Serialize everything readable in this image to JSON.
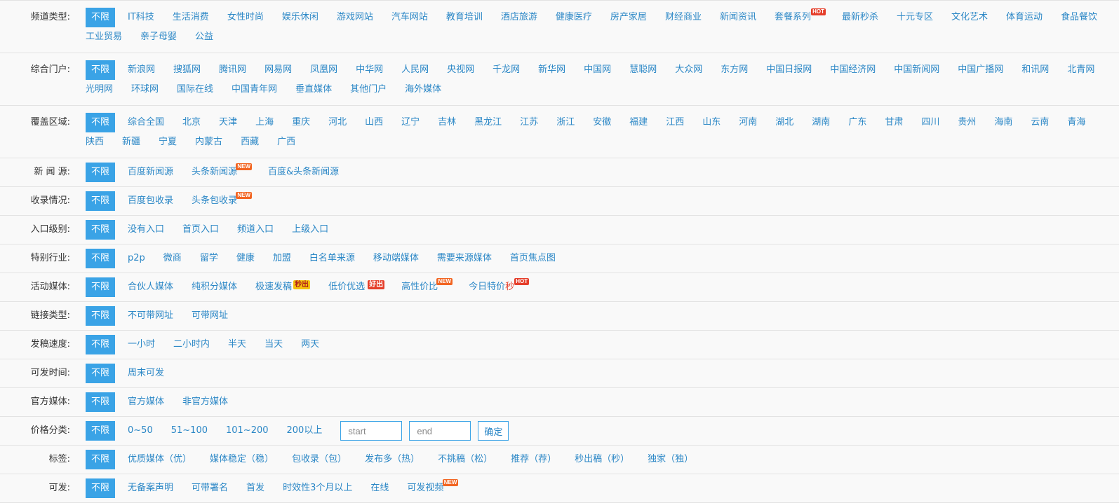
{
  "rows": [
    {
      "label": "频道类型:",
      "active": "不限",
      "items": [
        {
          "text": "IT科技"
        },
        {
          "text": "生活消费"
        },
        {
          "text": "女性时尚"
        },
        {
          "text": "娱乐休闲"
        },
        {
          "text": "游戏网站"
        },
        {
          "text": "汽车网站"
        },
        {
          "text": "教育培训"
        },
        {
          "text": "酒店旅游"
        },
        {
          "text": "健康医疗"
        },
        {
          "text": "房产家居"
        },
        {
          "text": "财经商业"
        },
        {
          "text": "新闻资讯"
        },
        {
          "text": "套餐系列",
          "badge": "HOT",
          "badge_type": "hot"
        },
        {
          "text": "最新秒杀"
        },
        {
          "text": "十元专区"
        },
        {
          "text": "文化艺术"
        },
        {
          "text": "体育运动"
        },
        {
          "text": "食品餐饮"
        },
        {
          "text": "工业贸易"
        },
        {
          "text": "亲子母婴"
        },
        {
          "text": "公益"
        }
      ]
    },
    {
      "label": "综合门户:",
      "active": "不限",
      "items": [
        {
          "text": "新浪网"
        },
        {
          "text": "搜狐网"
        },
        {
          "text": "腾讯网"
        },
        {
          "text": "网易网"
        },
        {
          "text": "凤凰网"
        },
        {
          "text": "中华网"
        },
        {
          "text": "人民网"
        },
        {
          "text": "央视网"
        },
        {
          "text": "千龙网"
        },
        {
          "text": "新华网"
        },
        {
          "text": "中国网"
        },
        {
          "text": "慧聪网"
        },
        {
          "text": "大众网"
        },
        {
          "text": "东方网"
        },
        {
          "text": "中国日报网"
        },
        {
          "text": "中国经济网"
        },
        {
          "text": "中国新闻网"
        },
        {
          "text": "中国广播网"
        },
        {
          "text": "和讯网"
        },
        {
          "text": "北青网"
        },
        {
          "text": "光明网"
        },
        {
          "text": "环球网"
        },
        {
          "text": "国际在线"
        },
        {
          "text": "中国青年网"
        },
        {
          "text": "垂直媒体"
        },
        {
          "text": "其他门户"
        },
        {
          "text": "海外媒体"
        }
      ]
    },
    {
      "label": "覆盖区域:",
      "active": "不限",
      "items": [
        {
          "text": "综合全国"
        },
        {
          "text": "北京"
        },
        {
          "text": "天津"
        },
        {
          "text": "上海"
        },
        {
          "text": "重庆"
        },
        {
          "text": "河北"
        },
        {
          "text": "山西"
        },
        {
          "text": "辽宁"
        },
        {
          "text": "吉林"
        },
        {
          "text": "黑龙江"
        },
        {
          "text": "江苏"
        },
        {
          "text": "浙江"
        },
        {
          "text": "安徽"
        },
        {
          "text": "福建"
        },
        {
          "text": "江西"
        },
        {
          "text": "山东"
        },
        {
          "text": "河南"
        },
        {
          "text": "湖北"
        },
        {
          "text": "湖南"
        },
        {
          "text": "广东"
        },
        {
          "text": "甘肃"
        },
        {
          "text": "四川"
        },
        {
          "text": "贵州"
        },
        {
          "text": "海南"
        },
        {
          "text": "云南"
        },
        {
          "text": "青海"
        },
        {
          "text": "陕西"
        },
        {
          "text": "新疆"
        },
        {
          "text": "宁夏"
        },
        {
          "text": "内蒙古"
        },
        {
          "text": "西藏"
        },
        {
          "text": "广西"
        }
      ]
    },
    {
      "label": "新 闻 源:",
      "active": "不限",
      "items": [
        {
          "text": "百度新闻源"
        },
        {
          "text": "头条新闻源",
          "badge": "NEW",
          "badge_type": "new"
        },
        {
          "text": "百度&头条新闻源"
        }
      ]
    },
    {
      "label": "收录情况:",
      "active": "不限",
      "items": [
        {
          "text": "百度包收录"
        },
        {
          "text": "头条包收录",
          "badge": "NEW",
          "badge_type": "new"
        }
      ]
    },
    {
      "label": "入口级别:",
      "active": "不限",
      "items": [
        {
          "text": "没有入口"
        },
        {
          "text": "首页入口"
        },
        {
          "text": "频道入口"
        },
        {
          "text": "上级入口"
        }
      ]
    },
    {
      "label": "特别行业:",
      "active": "不限",
      "items": [
        {
          "text": "p2p"
        },
        {
          "text": "微商"
        },
        {
          "text": "留学"
        },
        {
          "text": "健康"
        },
        {
          "text": "加盟"
        },
        {
          "text": "白名单来源"
        },
        {
          "text": "移动端媒体"
        },
        {
          "text": "需要来源媒体"
        },
        {
          "text": "首页焦点图"
        }
      ]
    },
    {
      "label": "活动媒体:",
      "active": "不限",
      "items": [
        {
          "text": "合伙人媒体"
        },
        {
          "text": "纯积分媒体"
        },
        {
          "text": "极速发稿",
          "badge": "秒出",
          "badge_type": "miao"
        },
        {
          "text": "低价优选",
          "badge": "好出",
          "badge_type": "haochu"
        },
        {
          "text": "高性价比",
          "badge": "NEW",
          "badge_type": "new"
        },
        {
          "text": "今日特价",
          "red_suffix": "秒",
          "badge": "HOT",
          "badge_type": "hot"
        }
      ]
    },
    {
      "label": "链接类型:",
      "active": "不限",
      "items": [
        {
          "text": "不可带网址"
        },
        {
          "text": "可带网址"
        }
      ]
    },
    {
      "label": "发稿速度:",
      "active": "不限",
      "items": [
        {
          "text": "一小时"
        },
        {
          "text": "二小时内"
        },
        {
          "text": "半天"
        },
        {
          "text": "当天"
        },
        {
          "text": "两天"
        }
      ]
    },
    {
      "label": "可发时间:",
      "active": "不限",
      "items": [
        {
          "text": "周末可发"
        }
      ]
    },
    {
      "label": "官方媒体:",
      "active": "不限",
      "items": [
        {
          "text": "官方媒体"
        },
        {
          "text": "非官方媒体"
        }
      ]
    },
    {
      "label": "价格分类:",
      "active": "不限",
      "items": [
        {
          "text": "0~50"
        },
        {
          "text": "51~100"
        },
        {
          "text": "101~200"
        },
        {
          "text": "200以上"
        }
      ],
      "price": {
        "start_placeholder": "start",
        "end_placeholder": "end",
        "confirm": "确定"
      }
    },
    {
      "label": "标签:",
      "active": "不限",
      "items": [
        {
          "text": "优质媒体（优）"
        },
        {
          "text": "媒体稳定（稳）"
        },
        {
          "text": "包收录（包）"
        },
        {
          "text": "发布多（热）"
        },
        {
          "text": "不挑稿（松）"
        },
        {
          "text": "推荐（荐）"
        },
        {
          "text": "秒出稿（秒）"
        },
        {
          "text": "独家（独）"
        }
      ]
    },
    {
      "label": "可发:",
      "active": "不限",
      "items": [
        {
          "text": "无备案声明"
        },
        {
          "text": "可带署名"
        },
        {
          "text": "首发"
        },
        {
          "text": "时效性3个月以上"
        },
        {
          "text": "在线"
        },
        {
          "text": "可发视频",
          "badge": "NEW",
          "badge_type": "new"
        }
      ]
    }
  ]
}
